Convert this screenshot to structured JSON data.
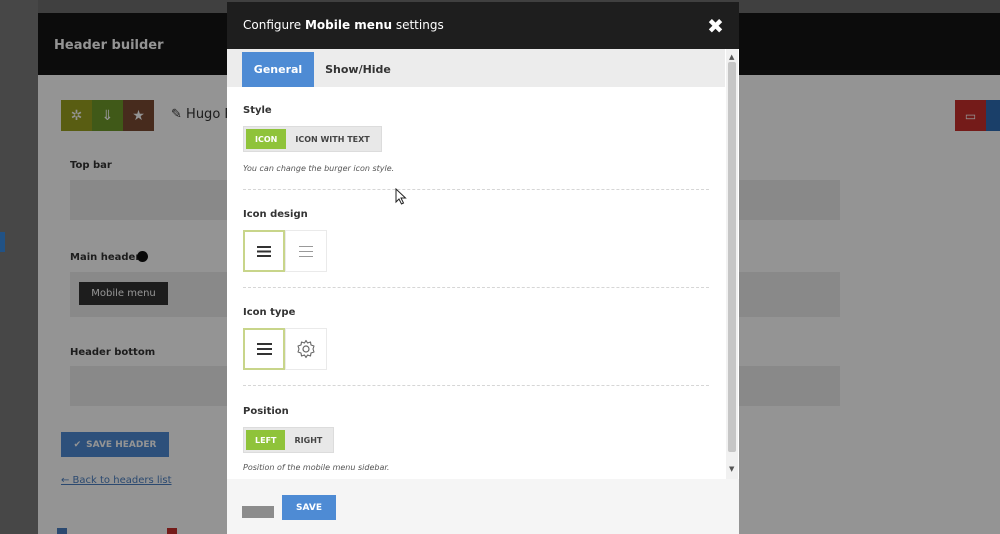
{
  "background": {
    "header_title": "Header builder",
    "header_name": "Hugo F",
    "sections": {
      "top_bar": "Top bar",
      "main_header": "Main header",
      "header_bottom": "Header bottom"
    },
    "mobile_menu_item": "Mobile menu",
    "save_header_label": "SAVE HEADER",
    "back_link": "← Back to headers list",
    "toolbar_icons": [
      "gear-icon",
      "download-icon",
      "star-icon"
    ],
    "toolbar_colors": [
      "#9aa11f",
      "#6f9a2a",
      "#7a4a32"
    ],
    "right_icons": [
      "monitor-icon"
    ]
  },
  "modal": {
    "title_prefix": "Configure ",
    "title_bold": "Mobile menu",
    "title_suffix": " settings",
    "close_glyph": "✖",
    "tabs": [
      {
        "label": "General",
        "active": true
      },
      {
        "label": "Show/Hide",
        "active": false
      }
    ],
    "style": {
      "label": "Style",
      "options": [
        "ICON",
        "ICON WITH TEXT"
      ],
      "selected": "ICON",
      "help": "You can change the burger icon style."
    },
    "icon_design": {
      "label": "Icon design",
      "options": [
        "burger-icon",
        "burger-thin-icon"
      ],
      "selected_index": 0
    },
    "icon_type": {
      "label": "Icon type",
      "options": [
        "burger-icon",
        "gear-icon"
      ],
      "selected_index": 0
    },
    "position": {
      "label": "Position",
      "options": [
        "LEFT",
        "RIGHT"
      ],
      "selected": "LEFT",
      "help": "Position of the mobile menu sidebar."
    },
    "footer": {
      "save_label": "SAVE"
    }
  },
  "colors": {
    "accent_blue": "#4e8bd4",
    "accent_green": "#8fc33a",
    "modal_header": "#1e1e1e"
  }
}
